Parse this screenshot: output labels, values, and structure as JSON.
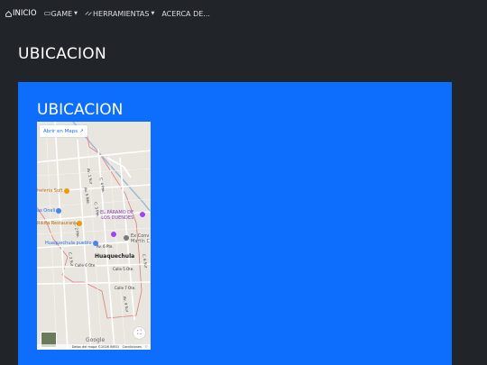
{
  "navbar": {
    "items": [
      {
        "label": "INICIO",
        "icon": "home-icon"
      },
      {
        "label": "GAME",
        "icon": "gamepad-icon",
        "dropdown": true
      },
      {
        "label": "HERRAMIENTAS",
        "icon": "tools-icon",
        "dropdown": true
      },
      {
        "label": "ACERCA DE..."
      }
    ]
  },
  "page": {
    "title": "UBICACION"
  },
  "card": {
    "title": "UBICACION"
  },
  "map": {
    "open_maps_label": "Abrir en Maps",
    "pois": [
      {
        "label": "heleria Soft"
      },
      {
        "label": "as Oneli"
      },
      {
        "label": "EL PÁRAMO DE"
      },
      {
        "label": "LOS DUENDES"
      },
      {
        "label": "Rikita Restaurant"
      },
      {
        "label": "Huaquechula pueblo"
      },
      {
        "label": "Ex Conv"
      },
      {
        "label": "Martín C"
      }
    ],
    "town_label": "Huaquechula",
    "streets": [
      "Av. 5 Nte.",
      "C. 3 Pte.",
      "C. 4 Pte.",
      "Calle 6 Ote.",
      "Calle 5 Ote.",
      "Calle 7 Ote.",
      "Av. 4 Sur",
      "C. 2 Sur",
      "Av. 1 Sur",
      "C. 6 Sur",
      "C. 2 Pte.",
      "Av. 6 Pte."
    ],
    "google_logo": "Google",
    "attribution": {
      "data": "Datos del mapa ©2026 INEGI",
      "terms": "Condiciones"
    },
    "colors": {
      "road": "#ffffff",
      "boundary": "#e07b7b",
      "river": "#9bb7d4"
    }
  }
}
